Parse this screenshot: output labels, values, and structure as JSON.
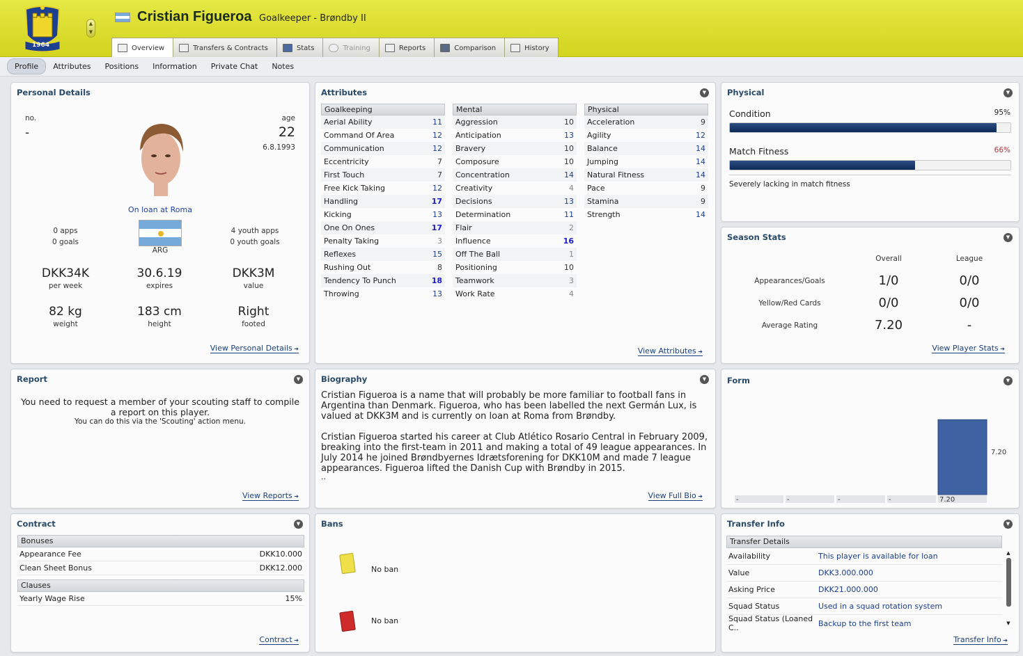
{
  "header": {
    "player_name": "Cristian Figueroa",
    "role": "Goalkeeper - Brøndby II",
    "crest_year": "1964",
    "tabs": [
      {
        "label": "Overview",
        "icon": "overview-icon"
      },
      {
        "label": "Transfers & Contracts",
        "icon": "document-icon"
      },
      {
        "label": "Stats",
        "icon": "stats-icon"
      },
      {
        "label": "Training",
        "icon": "cloud-icon"
      },
      {
        "label": "Reports",
        "icon": "report-icon"
      },
      {
        "label": "Comparison",
        "icon": "comparison-icon"
      },
      {
        "label": "History",
        "icon": "history-icon"
      }
    ]
  },
  "subnav": [
    "Profile",
    "Attributes",
    "Positions",
    "Information",
    "Private Chat",
    "Notes"
  ],
  "personal": {
    "title": "Personal Details",
    "no_label": "no.",
    "no_value": "-",
    "age_label": "age",
    "age_value": "22",
    "dob": "6.8.1993",
    "loan": "On loan at Roma",
    "apps": "0 apps",
    "goals": "0 goals",
    "nation": "ARG",
    "youth_apps": "4 youth apps",
    "youth_goals": "0 youth goals",
    "wage": "DKK34K",
    "wage_label": "per week",
    "expires": "30.6.19",
    "expires_label": "expires",
    "value": "DKK3M",
    "value_label": "value",
    "weight": "82 kg",
    "weight_label": "weight",
    "height": "183 cm",
    "height_label": "height",
    "foot": "Right",
    "foot_label": "footed",
    "link": "View Personal Details"
  },
  "attributes": {
    "title": "Attributes",
    "link": "View Attributes",
    "groups": [
      {
        "name": "Goalkeeping",
        "rows": [
          [
            "Aerial Ability",
            11
          ],
          [
            "Command Of Area",
            12
          ],
          [
            "Communication",
            12
          ],
          [
            "Eccentricity",
            7
          ],
          [
            "First Touch",
            7
          ],
          [
            "Free Kick Taking",
            12
          ],
          [
            "Handling",
            17
          ],
          [
            "Kicking",
            13
          ],
          [
            "One On Ones",
            17
          ],
          [
            "Penalty Taking",
            3
          ],
          [
            "Reflexes",
            15
          ],
          [
            "Rushing Out",
            8
          ],
          [
            "Tendency To Punch",
            18
          ],
          [
            "Throwing",
            13
          ]
        ]
      },
      {
        "name": "Mental",
        "rows": [
          [
            "Aggression",
            10
          ],
          [
            "Anticipation",
            13
          ],
          [
            "Bravery",
            10
          ],
          [
            "Composure",
            10
          ],
          [
            "Concentration",
            14
          ],
          [
            "Creativity",
            4
          ],
          [
            "Decisions",
            13
          ],
          [
            "Determination",
            11
          ],
          [
            "Flair",
            2
          ],
          [
            "Influence",
            16
          ],
          [
            "Off The Ball",
            1
          ],
          [
            "Positioning",
            10
          ],
          [
            "Teamwork",
            3
          ],
          [
            "Work Rate",
            4
          ]
        ]
      },
      {
        "name": "Physical",
        "rows": [
          [
            "Acceleration",
            9
          ],
          [
            "Agility",
            12
          ],
          [
            "Balance",
            14
          ],
          [
            "Jumping",
            14
          ],
          [
            "Natural Fitness",
            14
          ],
          [
            "Pace",
            9
          ],
          [
            "Stamina",
            9
          ],
          [
            "Strength",
            14
          ]
        ]
      }
    ]
  },
  "physical": {
    "title": "Physical",
    "condition_label": "Condition",
    "condition_value": "95%",
    "condition_pct": 95,
    "fitness_label": "Match Fitness",
    "fitness_value": "66%",
    "fitness_pct": 66,
    "note": "Severely lacking in match fitness",
    "fitness_color": "#b8323a"
  },
  "season": {
    "title": "Season Stats",
    "col_overall": "Overall",
    "col_league": "League",
    "rows": [
      {
        "label": "Appearances/Goals",
        "overall": "1/0",
        "league": "0/0"
      },
      {
        "label": "Yellow/Red Cards",
        "overall": "0/0",
        "league": "0/0"
      },
      {
        "label": "Average Rating",
        "overall": "7.20",
        "league": "-"
      }
    ],
    "link": "View Player Stats"
  },
  "report": {
    "title": "Report",
    "line1": "You need to request a member of your scouting staff to compile a report on this player.",
    "line2": "You can do this via the 'Scouting' action menu.",
    "link": "View Reports"
  },
  "biography": {
    "title": "Biography",
    "p1": "Cristian Figueroa is a name that will probably be more familiar to football fans in Argentina than Denmark. Figueroa, who has been labelled the next Germán Lux, is valued at DKK3M and is currently on loan at Roma from Brøndby.",
    "p2": "Cristian Figueroa started his career at Club Atlético Rosario Central in February 2009, breaking into the first-team in 2011 and making a total of 49 league appearances. In July 2014 he joined Brøndbyernes Idrætsforening for DKK10M and made 7 league appearances.  Figueroa lifted the Danish Cup with Brøndby in 2015.",
    "ellipsis": "..",
    "link": "View Full Bio"
  },
  "form": {
    "title": "Form",
    "value_label": "7.20",
    "slots": [
      "-",
      "-",
      "-",
      "-",
      "7.20"
    ],
    "bar_color": "#3f62a3"
  },
  "chart_data": {
    "type": "bar",
    "categories": [
      "1",
      "2",
      "3",
      "4",
      "5"
    ],
    "values": [
      null,
      null,
      null,
      null,
      7.2
    ],
    "ylim": [
      0,
      10
    ]
  },
  "contract": {
    "title": "Contract",
    "bonuses_label": "Bonuses",
    "bonuses": [
      {
        "label": "Appearance Fee",
        "value": "DKK10.000"
      },
      {
        "label": "Clean Sheet Bonus",
        "value": "DKK12.000"
      }
    ],
    "clauses_label": "Clauses",
    "clauses": [
      {
        "label": "Yearly Wage Rise",
        "value": "15%"
      }
    ],
    "link": "Contract"
  },
  "bans": {
    "title": "Bans",
    "yellow": "No ban",
    "red": "No ban"
  },
  "transfer": {
    "title": "Transfer Info",
    "section": "Transfer Details",
    "rows": [
      {
        "label": "Availability",
        "value": "This player is available for loan"
      },
      {
        "label": "Value",
        "value": "DKK3.000.000"
      },
      {
        "label": "Asking Price",
        "value": "DKK21.000.000"
      },
      {
        "label": "Squad Status",
        "value": "Used in a squad rotation system"
      },
      {
        "label": "Squad Status (Loaned C..",
        "value": "Backup to the first team"
      }
    ],
    "link": "Transfer Info"
  }
}
